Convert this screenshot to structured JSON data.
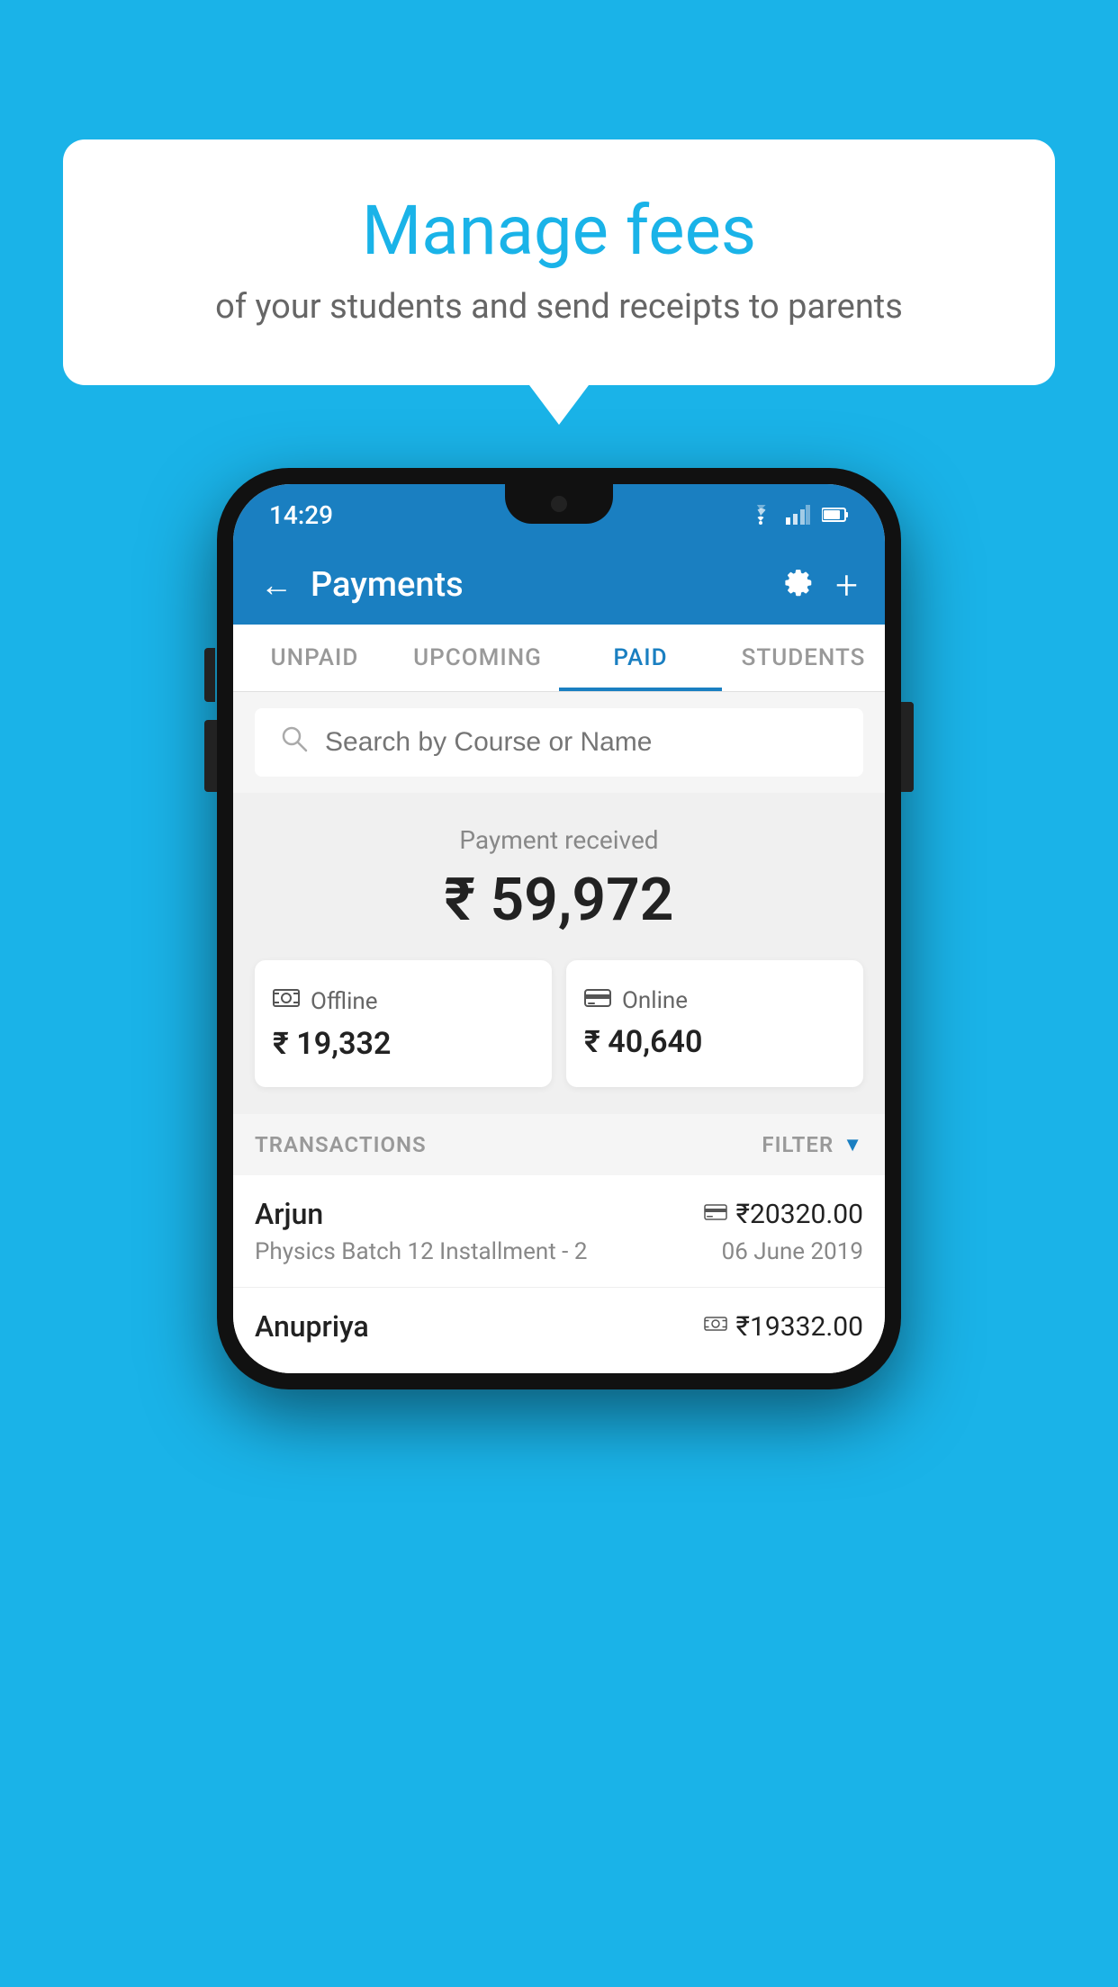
{
  "background_color": "#1ab3e8",
  "bubble": {
    "title": "Manage fees",
    "subtitle": "of your students and send receipts to parents"
  },
  "status_bar": {
    "time": "14:29",
    "wifi_icon": "wifi",
    "signal_icon": "signal",
    "battery_icon": "battery"
  },
  "header": {
    "back_label": "←",
    "title": "Payments",
    "settings_icon": "gear",
    "add_icon": "+"
  },
  "tabs": [
    {
      "label": "UNPAID",
      "active": false
    },
    {
      "label": "UPCOMING",
      "active": false
    },
    {
      "label": "PAID",
      "active": true
    },
    {
      "label": "STUDENTS",
      "active": false
    }
  ],
  "search": {
    "placeholder": "Search by Course or Name"
  },
  "payment_summary": {
    "label": "Payment received",
    "amount": "₹ 59,972",
    "offline": {
      "label": "Offline",
      "amount": "₹ 19,332"
    },
    "online": {
      "label": "Online",
      "amount": "₹ 40,640"
    }
  },
  "transactions": {
    "label": "TRANSACTIONS",
    "filter_label": "FILTER",
    "items": [
      {
        "name": "Arjun",
        "payment_type": "card",
        "amount": "₹20320.00",
        "course": "Physics Batch 12 Installment - 2",
        "date": "06 June 2019"
      },
      {
        "name": "Anupriya",
        "payment_type": "cash",
        "amount": "₹19332.00",
        "course": "",
        "date": ""
      }
    ]
  }
}
